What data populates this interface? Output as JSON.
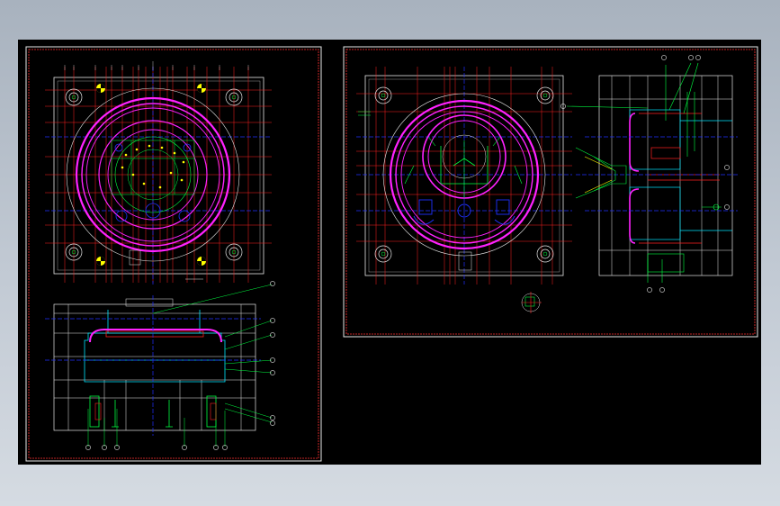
{
  "window": {
    "title": ""
  },
  "colors": {
    "background_gradient_top": "#a8b2be",
    "background_gradient_bottom": "#d5dbe2",
    "canvas": "#000000",
    "frame_red": "#ff3030",
    "frame_white": "#e8e8e8",
    "magenta": "#ff22ff",
    "red": "#ff2020",
    "blue": "#2030ff",
    "green": "#00ff40",
    "yellow": "#ffff00",
    "cyan": "#00e5ff",
    "white": "#e6e6e6"
  },
  "drawing": {
    "sheet_left": {
      "view_top_label": "",
      "view_section_label": ""
    },
    "sheet_right": {
      "view_cavity_label": "",
      "view_side_label": "",
      "detail_label": ""
    }
  },
  "icons": [
    "balloon-callout-icon",
    "center-mark-icon"
  ]
}
